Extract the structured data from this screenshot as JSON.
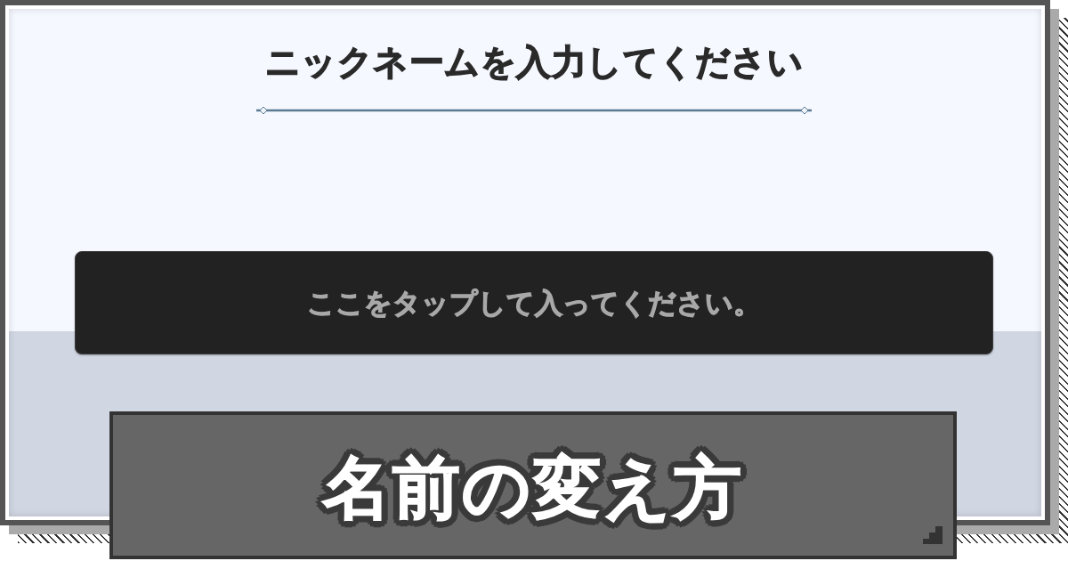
{
  "screenshot": {
    "heading": "ニックネームを入力してください",
    "input": {
      "placeholder": "ここをタップして入ってください。"
    }
  },
  "caption": {
    "title": "名前の変え方"
  }
}
